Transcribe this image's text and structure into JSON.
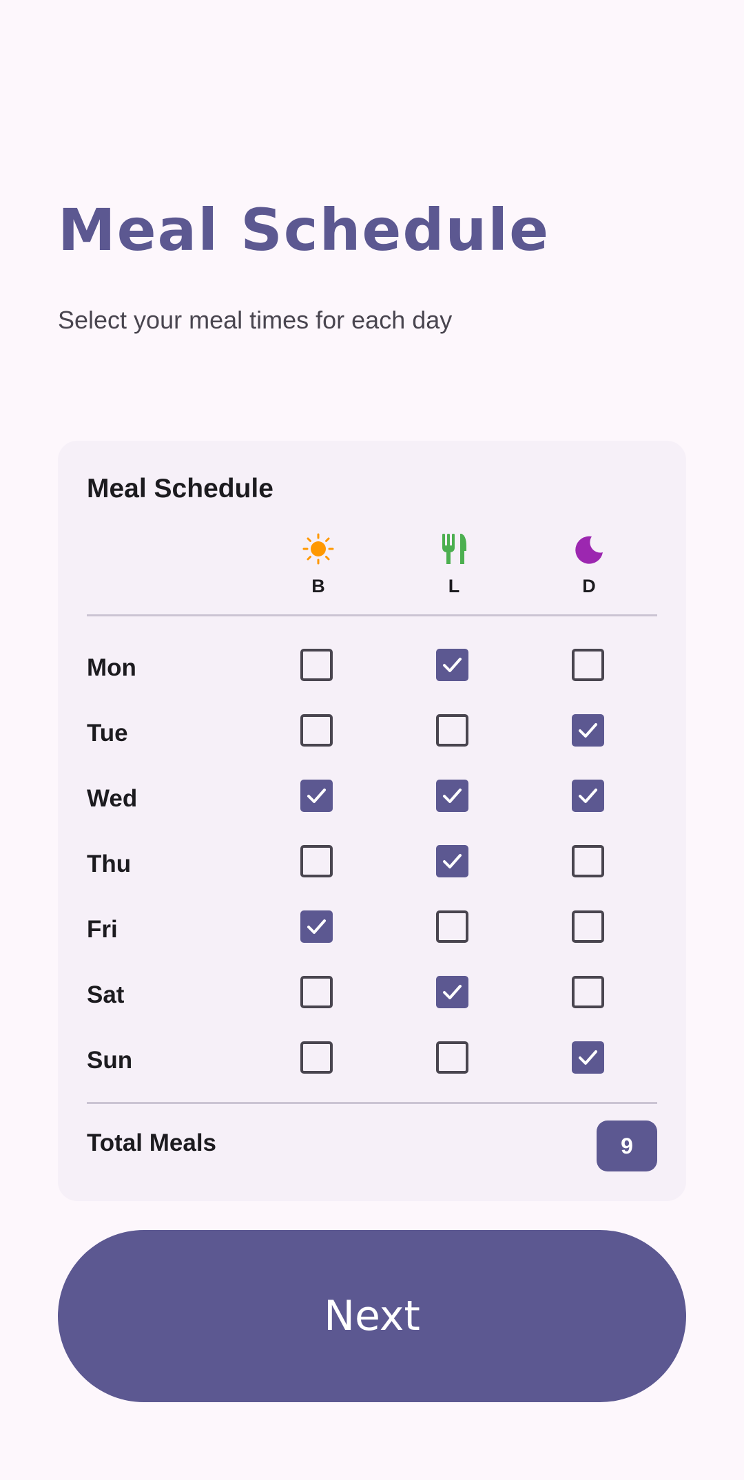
{
  "header": {
    "title": "Meal Schedule",
    "subtitle": "Select your meal times for each day"
  },
  "card": {
    "title": "Meal Schedule",
    "columns": [
      {
        "label": "B",
        "icon": "sun-icon",
        "color": "#ff9800"
      },
      {
        "label": "L",
        "icon": "fork-knife-icon",
        "color": "#4caf50"
      },
      {
        "label": "D",
        "icon": "moon-icon",
        "color": "#9c27b0"
      }
    ],
    "days": [
      {
        "label": "Mon",
        "meals": [
          false,
          true,
          false
        ]
      },
      {
        "label": "Tue",
        "meals": [
          false,
          false,
          true
        ]
      },
      {
        "label": "Wed",
        "meals": [
          true,
          true,
          true
        ]
      },
      {
        "label": "Thu",
        "meals": [
          false,
          true,
          false
        ]
      },
      {
        "label": "Fri",
        "meals": [
          true,
          false,
          false
        ]
      },
      {
        "label": "Sat",
        "meals": [
          false,
          true,
          false
        ]
      },
      {
        "label": "Sun",
        "meals": [
          false,
          false,
          true
        ]
      }
    ],
    "total_label": "Total Meals",
    "total_value": "9"
  },
  "next_button": {
    "label": "Next"
  },
  "colors": {
    "accent": "#5c5891",
    "background": "#fdf7fc",
    "card": "#f6f0f8"
  }
}
